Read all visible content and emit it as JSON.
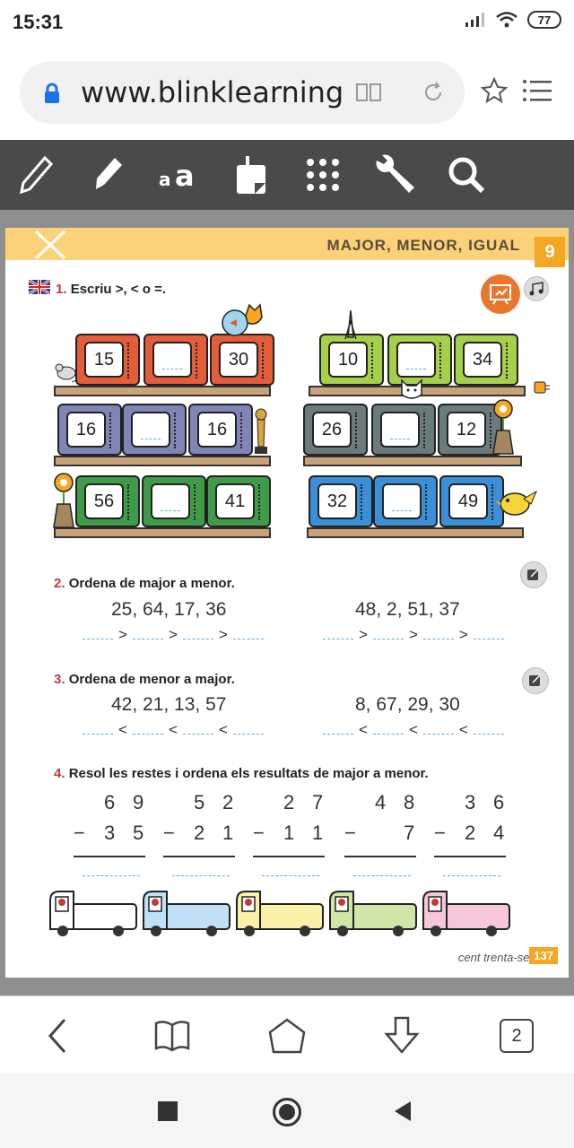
{
  "status": {
    "time": "15:31",
    "battery": "77"
  },
  "browser": {
    "url": "www.blinklearning",
    "tab_count": "2"
  },
  "page": {
    "header_title": "MAJOR, MENOR, IGUAL",
    "unit_number": "9",
    "footer_text": "cent trenta-set",
    "footer_page": "137"
  },
  "ex1": {
    "num": "1.",
    "instruction": "Escriu >, < o =.",
    "left_tvs": [
      "15",
      "",
      "30",
      "16",
      "",
      "16",
      "56",
      "",
      "41"
    ],
    "right_tvs": [
      "10",
      "",
      "34",
      "26",
      "",
      "12",
      "32",
      "",
      "49"
    ]
  },
  "ex2": {
    "num": "2.",
    "instruction": "Ordena de major a menor.",
    "set_a": "25, 64, 17, 36",
    "set_b": "48, 2, 51, 37",
    "sign": ">"
  },
  "ex3": {
    "num": "3.",
    "instruction": "Ordena de menor a major.",
    "set_a": "42, 21, 13, 57",
    "set_b": "8, 67, 29, 30",
    "sign": "<"
  },
  "ex4": {
    "num": "4.",
    "instruction": "Resol les restes i ordena els resultats de major a menor.",
    "subtractions": [
      {
        "top": [
          "6",
          "9"
        ],
        "bottom": [
          "3",
          "5"
        ],
        "op": "−"
      },
      {
        "top": [
          "5",
          "2"
        ],
        "bottom": [
          "2",
          "1"
        ],
        "op": "−"
      },
      {
        "top": [
          "2",
          "7"
        ],
        "bottom": [
          "1",
          "1"
        ],
        "op": "−"
      },
      {
        "top": [
          "4",
          "8"
        ],
        "bottom": [
          "",
          "7"
        ],
        "op": "−"
      },
      {
        "top": [
          "3",
          "6"
        ],
        "bottom": [
          "2",
          "4"
        ],
        "op": "−"
      }
    ],
    "truck_colors": [
      "#ffffff",
      "#bfe0f5",
      "#fbf0a8",
      "#cfe6a8",
      "#f6c6da"
    ]
  },
  "colors": {
    "toolbar": "#4a4a4a",
    "header": "#fbd27a",
    "accent_orange": "#f5a623",
    "tv_colors": [
      "#e35d3a",
      "#e35d3a",
      "#e35d3a",
      "#7f86b5",
      "#7f86b5",
      "#7f86b5",
      "#3f9a4a",
      "#3f9a4a",
      "#3f9a4a"
    ],
    "tv_colors_right": [
      "#a6cf4a",
      "#a6cf4a",
      "#a6cf4a",
      "#6b7b7b",
      "#6b7b7b",
      "#6b7b7b",
      "#3b8fd6",
      "#3b8fd6",
      "#3b8fd6"
    ]
  }
}
